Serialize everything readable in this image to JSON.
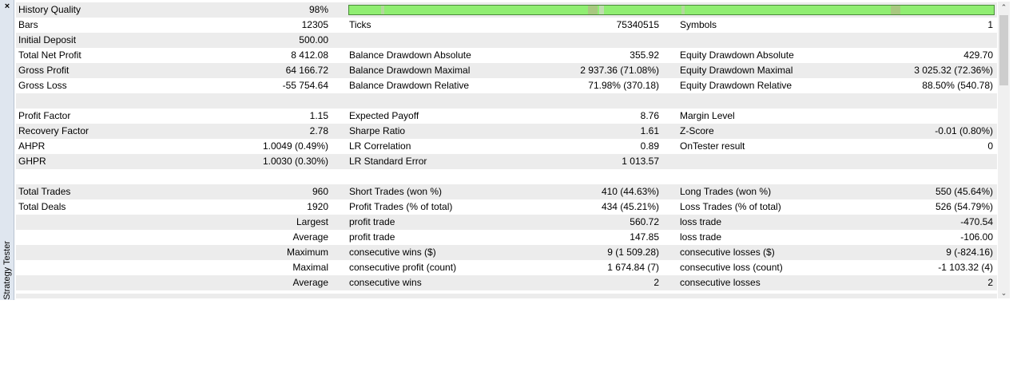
{
  "panel": {
    "title": "Strategy Tester",
    "close_glyph": "×"
  },
  "quality": {
    "level": 0.98,
    "segments": [
      {
        "start": 0.0,
        "end": 0.05,
        "color": "#90ee72"
      },
      {
        "start": 0.05,
        "end": 0.054,
        "color": "#b3d89c"
      },
      {
        "start": 0.37,
        "end": 0.385,
        "color": "#a8c880"
      },
      {
        "start": 0.388,
        "end": 0.395,
        "color": "#c0dcb0"
      },
      {
        "start": 0.515,
        "end": 0.52,
        "color": "#b3d89c"
      },
      {
        "start": 0.84,
        "end": 0.855,
        "color": "#a8c880"
      }
    ]
  },
  "rows": [
    {
      "alt": true,
      "c1l": "History Quality",
      "c1v": "98%",
      "c2l": "",
      "c2v": "",
      "c3l": "",
      "c3v": "",
      "bar": true
    },
    {
      "alt": false,
      "c1l": "Bars",
      "c1v": "12305",
      "c2l": "Ticks",
      "c2v": "75340515",
      "c3l": "Symbols",
      "c3v": "1"
    },
    {
      "alt": true,
      "c1l": "Initial Deposit",
      "c1v": "500.00",
      "c2l": "",
      "c2v": "",
      "c3l": "",
      "c3v": ""
    },
    {
      "alt": false,
      "c1l": "Total Net Profit",
      "c1v": "8 412.08",
      "c2l": "Balance Drawdown Absolute",
      "c2v": "355.92",
      "c3l": "Equity Drawdown Absolute",
      "c3v": "429.70"
    },
    {
      "alt": true,
      "c1l": "Gross Profit",
      "c1v": "64 166.72",
      "c2l": "Balance Drawdown Maximal",
      "c2v": "2 937.36 (71.08%)",
      "c3l": "Equity Drawdown Maximal",
      "c3v": "3 025.32 (72.36%)"
    },
    {
      "alt": false,
      "c1l": "Gross Loss",
      "c1v": "-55 754.64",
      "c2l": "Balance Drawdown Relative",
      "c2v": "71.98% (370.18)",
      "c3l": "Equity Drawdown Relative",
      "c3v": "88.50% (540.78)"
    },
    {
      "alt": true,
      "c1l": "",
      "c1v": "",
      "c2l": "",
      "c2v": "",
      "c3l": "",
      "c3v": ""
    },
    {
      "alt": false,
      "c1l": "Profit Factor",
      "c1v": "1.15",
      "c2l": "Expected Payoff",
      "c2v": "8.76",
      "c3l": "Margin Level",
      "c3v": ""
    },
    {
      "alt": true,
      "c1l": "Recovery Factor",
      "c1v": "2.78",
      "c2l": "Sharpe Ratio",
      "c2v": "1.61",
      "c3l": "Z-Score",
      "c3v": "-0.01 (0.80%)"
    },
    {
      "alt": false,
      "c1l": "AHPR",
      "c1v": "1.0049 (0.49%)",
      "c2l": "LR Correlation",
      "c2v": "0.89",
      "c3l": "OnTester result",
      "c3v": "0"
    },
    {
      "alt": true,
      "c1l": "GHPR",
      "c1v": "1.0030 (0.30%)",
      "c2l": "LR Standard Error",
      "c2v": "1 013.57",
      "c3l": "",
      "c3v": ""
    },
    {
      "alt": false,
      "c1l": "",
      "c1v": "",
      "c2l": "",
      "c2v": "",
      "c3l": "",
      "c3v": ""
    },
    {
      "alt": true,
      "c1l": "Total Trades",
      "c1v": "960",
      "c2l": "Short Trades (won %)",
      "c2v": "410 (44.63%)",
      "c3l": "Long Trades (won %)",
      "c3v": "550 (45.64%)"
    },
    {
      "alt": false,
      "c1l": "Total Deals",
      "c1v": "1920",
      "c2l": "Profit Trades (% of total)",
      "c2v": "434 (45.21%)",
      "c3l": "Loss Trades (% of total)",
      "c3v": "526 (54.79%)"
    },
    {
      "alt": true,
      "c1l": "",
      "c1v": "Largest",
      "c2l": "profit trade",
      "c2v": "560.72",
      "c3l": "loss trade",
      "c3v": "-470.54"
    },
    {
      "alt": false,
      "c1l": "",
      "c1v": "Average",
      "c2l": "profit trade",
      "c2v": "147.85",
      "c3l": "loss trade",
      "c3v": "-106.00"
    },
    {
      "alt": true,
      "c1l": "",
      "c1v": "Maximum",
      "c2l": "consecutive wins ($)",
      "c2v": "9 (1 509.28)",
      "c3l": "consecutive losses ($)",
      "c3v": "9 (-824.16)"
    },
    {
      "alt": false,
      "c1l": "",
      "c1v": "Maximal",
      "c2l": "consecutive profit (count)",
      "c2v": "1 674.84 (7)",
      "c3l": "consecutive loss (count)",
      "c3v": "-1 103.32 (4)"
    },
    {
      "alt": true,
      "c1l": "",
      "c1v": "Average",
      "c2l": "consecutive wins",
      "c2v": "2",
      "c3l": "consecutive losses",
      "c3v": "2"
    }
  ],
  "scroll": {
    "up_glyph": "⌃",
    "down_glyph": "⌄"
  }
}
